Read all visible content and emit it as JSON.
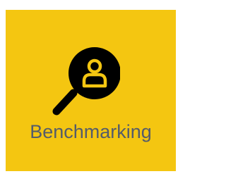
{
  "tile": {
    "label": "Benchmarking",
    "background_color": "#f4c611",
    "icon": "magnifier-person-icon",
    "icon_color": "#000000",
    "icon_accent_color": "#f4c611",
    "label_color": "#555c6a"
  }
}
